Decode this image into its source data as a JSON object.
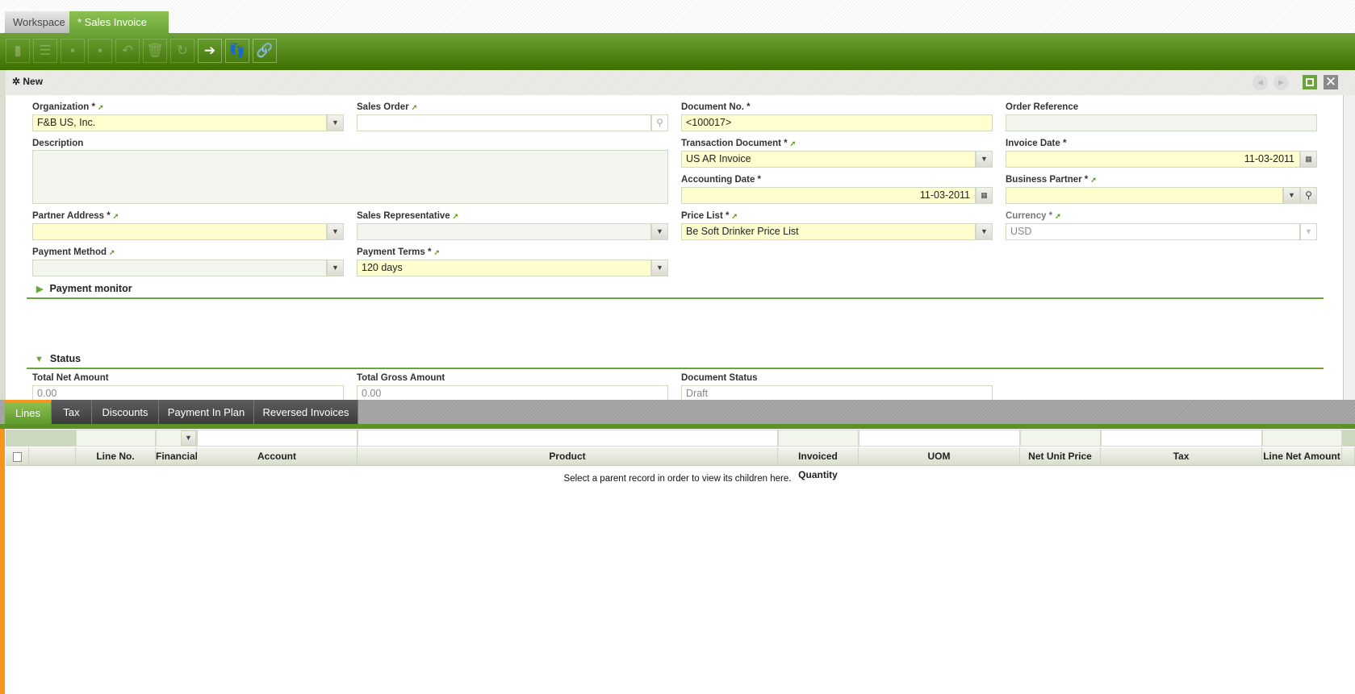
{
  "top_tabs": [
    {
      "label": "Workspace"
    },
    {
      "label": "* Sales Invoice",
      "close": "×"
    }
  ],
  "toolbar": {
    "buttons": [
      {
        "name": "new-document",
        "icon": "new-doc-icon",
        "enabled": false
      },
      {
        "name": "new-row",
        "icon": "grid-new-icon",
        "enabled": false
      },
      {
        "name": "save",
        "icon": "save-icon",
        "enabled": false
      },
      {
        "name": "save-close",
        "icon": "save-close-icon",
        "enabled": false
      },
      {
        "name": "undo",
        "icon": "undo-icon",
        "enabled": false
      },
      {
        "name": "delete",
        "icon": "trash-icon",
        "enabled": false
      },
      {
        "name": "refresh",
        "icon": "refresh-icon",
        "enabled": false
      },
      {
        "name": "export",
        "icon": "export-icon",
        "enabled": true
      },
      {
        "name": "audit-trail",
        "icon": "footprints-icon",
        "enabled": true
      },
      {
        "name": "link",
        "icon": "link-icon",
        "enabled": true
      }
    ]
  },
  "header": {
    "title": "New"
  },
  "form": {
    "organization": {
      "label": "Organization *",
      "value": "F&B US, Inc."
    },
    "sales_order": {
      "label": "Sales Order",
      "value": ""
    },
    "document_no": {
      "label": "Document No. *",
      "value": "<100017>"
    },
    "order_reference": {
      "label": "Order Reference",
      "value": ""
    },
    "description": {
      "label": "Description",
      "value": ""
    },
    "transaction_document": {
      "label": "Transaction Document *",
      "value": "US AR Invoice"
    },
    "invoice_date": {
      "label": "Invoice Date *",
      "value": "11-03-2011"
    },
    "accounting_date": {
      "label": "Accounting Date *",
      "value": "11-03-2011"
    },
    "business_partner": {
      "label": "Business Partner *",
      "value": ""
    },
    "partner_address": {
      "label": "Partner Address *",
      "value": ""
    },
    "sales_representative": {
      "label": "Sales Representative",
      "value": ""
    },
    "price_list": {
      "label": "Price List *",
      "value": "Be Soft Drinker Price List"
    },
    "currency": {
      "label": "Currency *",
      "value": "USD"
    },
    "payment_method": {
      "label": "Payment Method",
      "value": ""
    },
    "payment_terms": {
      "label": "Payment Terms *",
      "value": "120 days"
    }
  },
  "sections": {
    "payment_monitor": "Payment monitor",
    "status": "Status"
  },
  "status": {
    "total_net": {
      "label": "Total Net Amount",
      "value": "0.00"
    },
    "total_gross": {
      "label": "Total Gross Amount",
      "value": "0.00"
    },
    "document_status": {
      "label": "Document Status",
      "value": "Draft"
    }
  },
  "child_tabs": [
    {
      "label": "Lines"
    },
    {
      "label": "Tax"
    },
    {
      "label": "Discounts"
    },
    {
      "label": "Payment In Plan"
    },
    {
      "label": "Reversed Invoices"
    }
  ],
  "grid": {
    "columns": [
      "Line No.",
      "Financial",
      "Account",
      "Product",
      "Invoiced Quantity",
      "UOM",
      "Net Unit Price",
      "Tax",
      "Line Net Amount"
    ],
    "empty_message": "Select a parent record in order to view its children here."
  },
  "colors": {
    "brand_green": "#6aa53a",
    "required_bg": "#fefecf",
    "accent_orange": "#f7941d"
  }
}
